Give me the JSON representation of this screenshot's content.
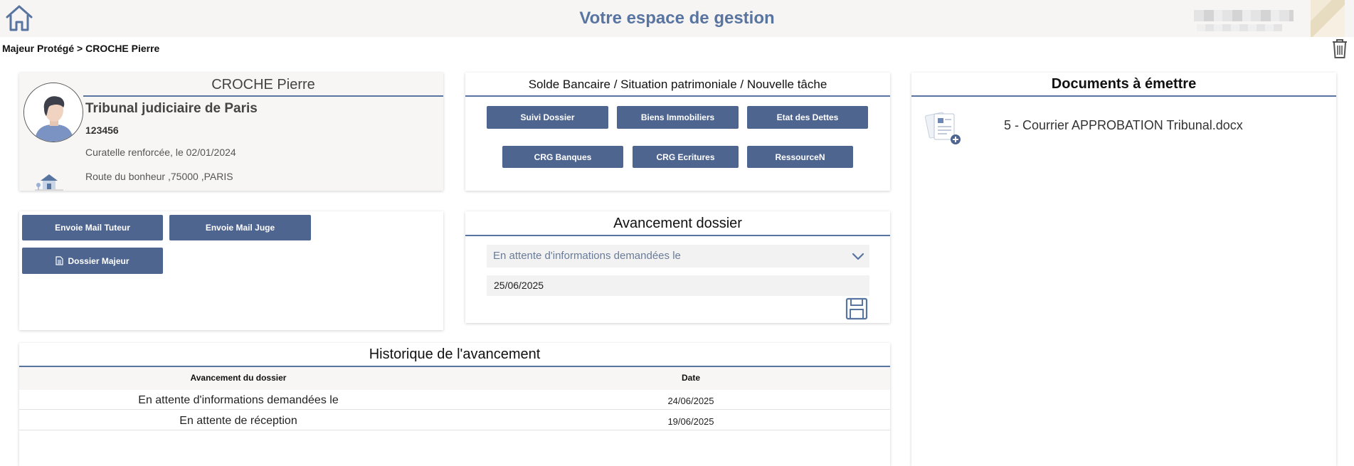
{
  "header": {
    "title": "Votre espace de gestion",
    "home_icon": "home-icon",
    "accent_color": "#5874a0"
  },
  "breadcrumb": "Majeur Protégé > CROCHE Pierre",
  "person": {
    "name": "CROCHE Pierre",
    "tribunal": "Tribunal judiciaire de Paris",
    "case_number": "123456",
    "measure": "Curatelle renforcée, le 02/01/2024",
    "address": "Route du bonheur ,75000 ,PARIS"
  },
  "actions": {
    "title": "Solde Bancaire / Situation patrimoniale / Nouvelle tâche",
    "buttons": [
      "Suivi Dossier",
      "Biens Immobiliers",
      "Etat des Dettes",
      "CRG Banques",
      "CRG Ecritures",
      "RessourceN"
    ]
  },
  "mail": {
    "buttons": [
      "Envoie Mail Tuteur",
      "Envoie Mail Juge"
    ],
    "dossier_button": "Dossier Majeur"
  },
  "avancement": {
    "title": "Avancement dossier",
    "status_value": "En attente d'informations demandées le",
    "date_value": "25/06/2025"
  },
  "historique": {
    "title": "Historique de l'avancement",
    "columns": [
      "Avancement du dossier",
      "Date"
    ],
    "rows": [
      [
        "En attente d'informations demandées le",
        "24/06/2025"
      ],
      [
        "En attente de réception",
        "19/06/2025"
      ]
    ]
  },
  "documents": {
    "title": "Documents à émettre",
    "items": [
      "5 - Courrier APPROBATION Tribunal.docx"
    ]
  },
  "button_color": "#4e6590"
}
